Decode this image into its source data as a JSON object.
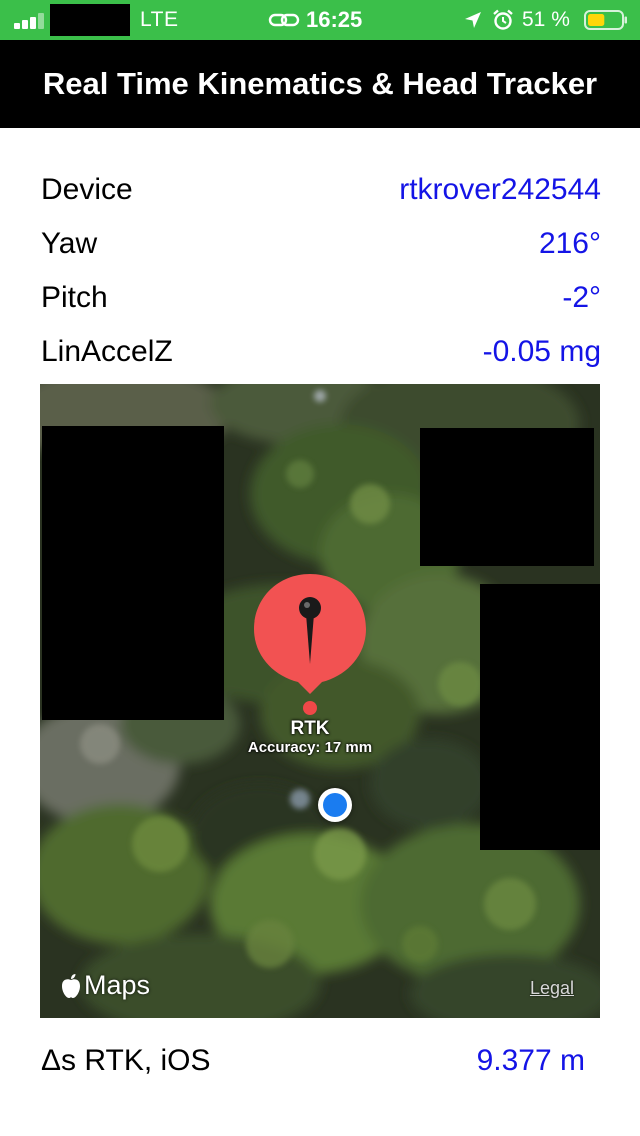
{
  "status_bar": {
    "network": "LTE",
    "time": "16:25",
    "battery_percent": "51 %",
    "battery_level": 0.51,
    "background_color": "#3bbf4a",
    "icons": [
      "signal-icon",
      "link-icon",
      "location-arrow-icon",
      "alarm-icon",
      "battery-icon"
    ]
  },
  "nav": {
    "title": "Real Time Kinematics & Head Tracker"
  },
  "info": {
    "device_label": "Device",
    "device_value": "rtkrover242544",
    "yaw_label": "Yaw",
    "yaw_value": "216°",
    "pitch_label": "Pitch",
    "pitch_value": "-2°",
    "accel_label": "LinAccelZ",
    "accel_value": "-0.05 mg",
    "value_color": "#1414e6"
  },
  "map": {
    "pin_title": "RTK",
    "pin_subtitle": "Accuracy: 17 mm",
    "pin_color": "#f25252",
    "user_dot_color": "#1a7cf0",
    "logo_text": "Maps",
    "legal_text": "Legal"
  },
  "delta": {
    "label": "Δs RTK, iOS",
    "value": "9.377 m"
  }
}
